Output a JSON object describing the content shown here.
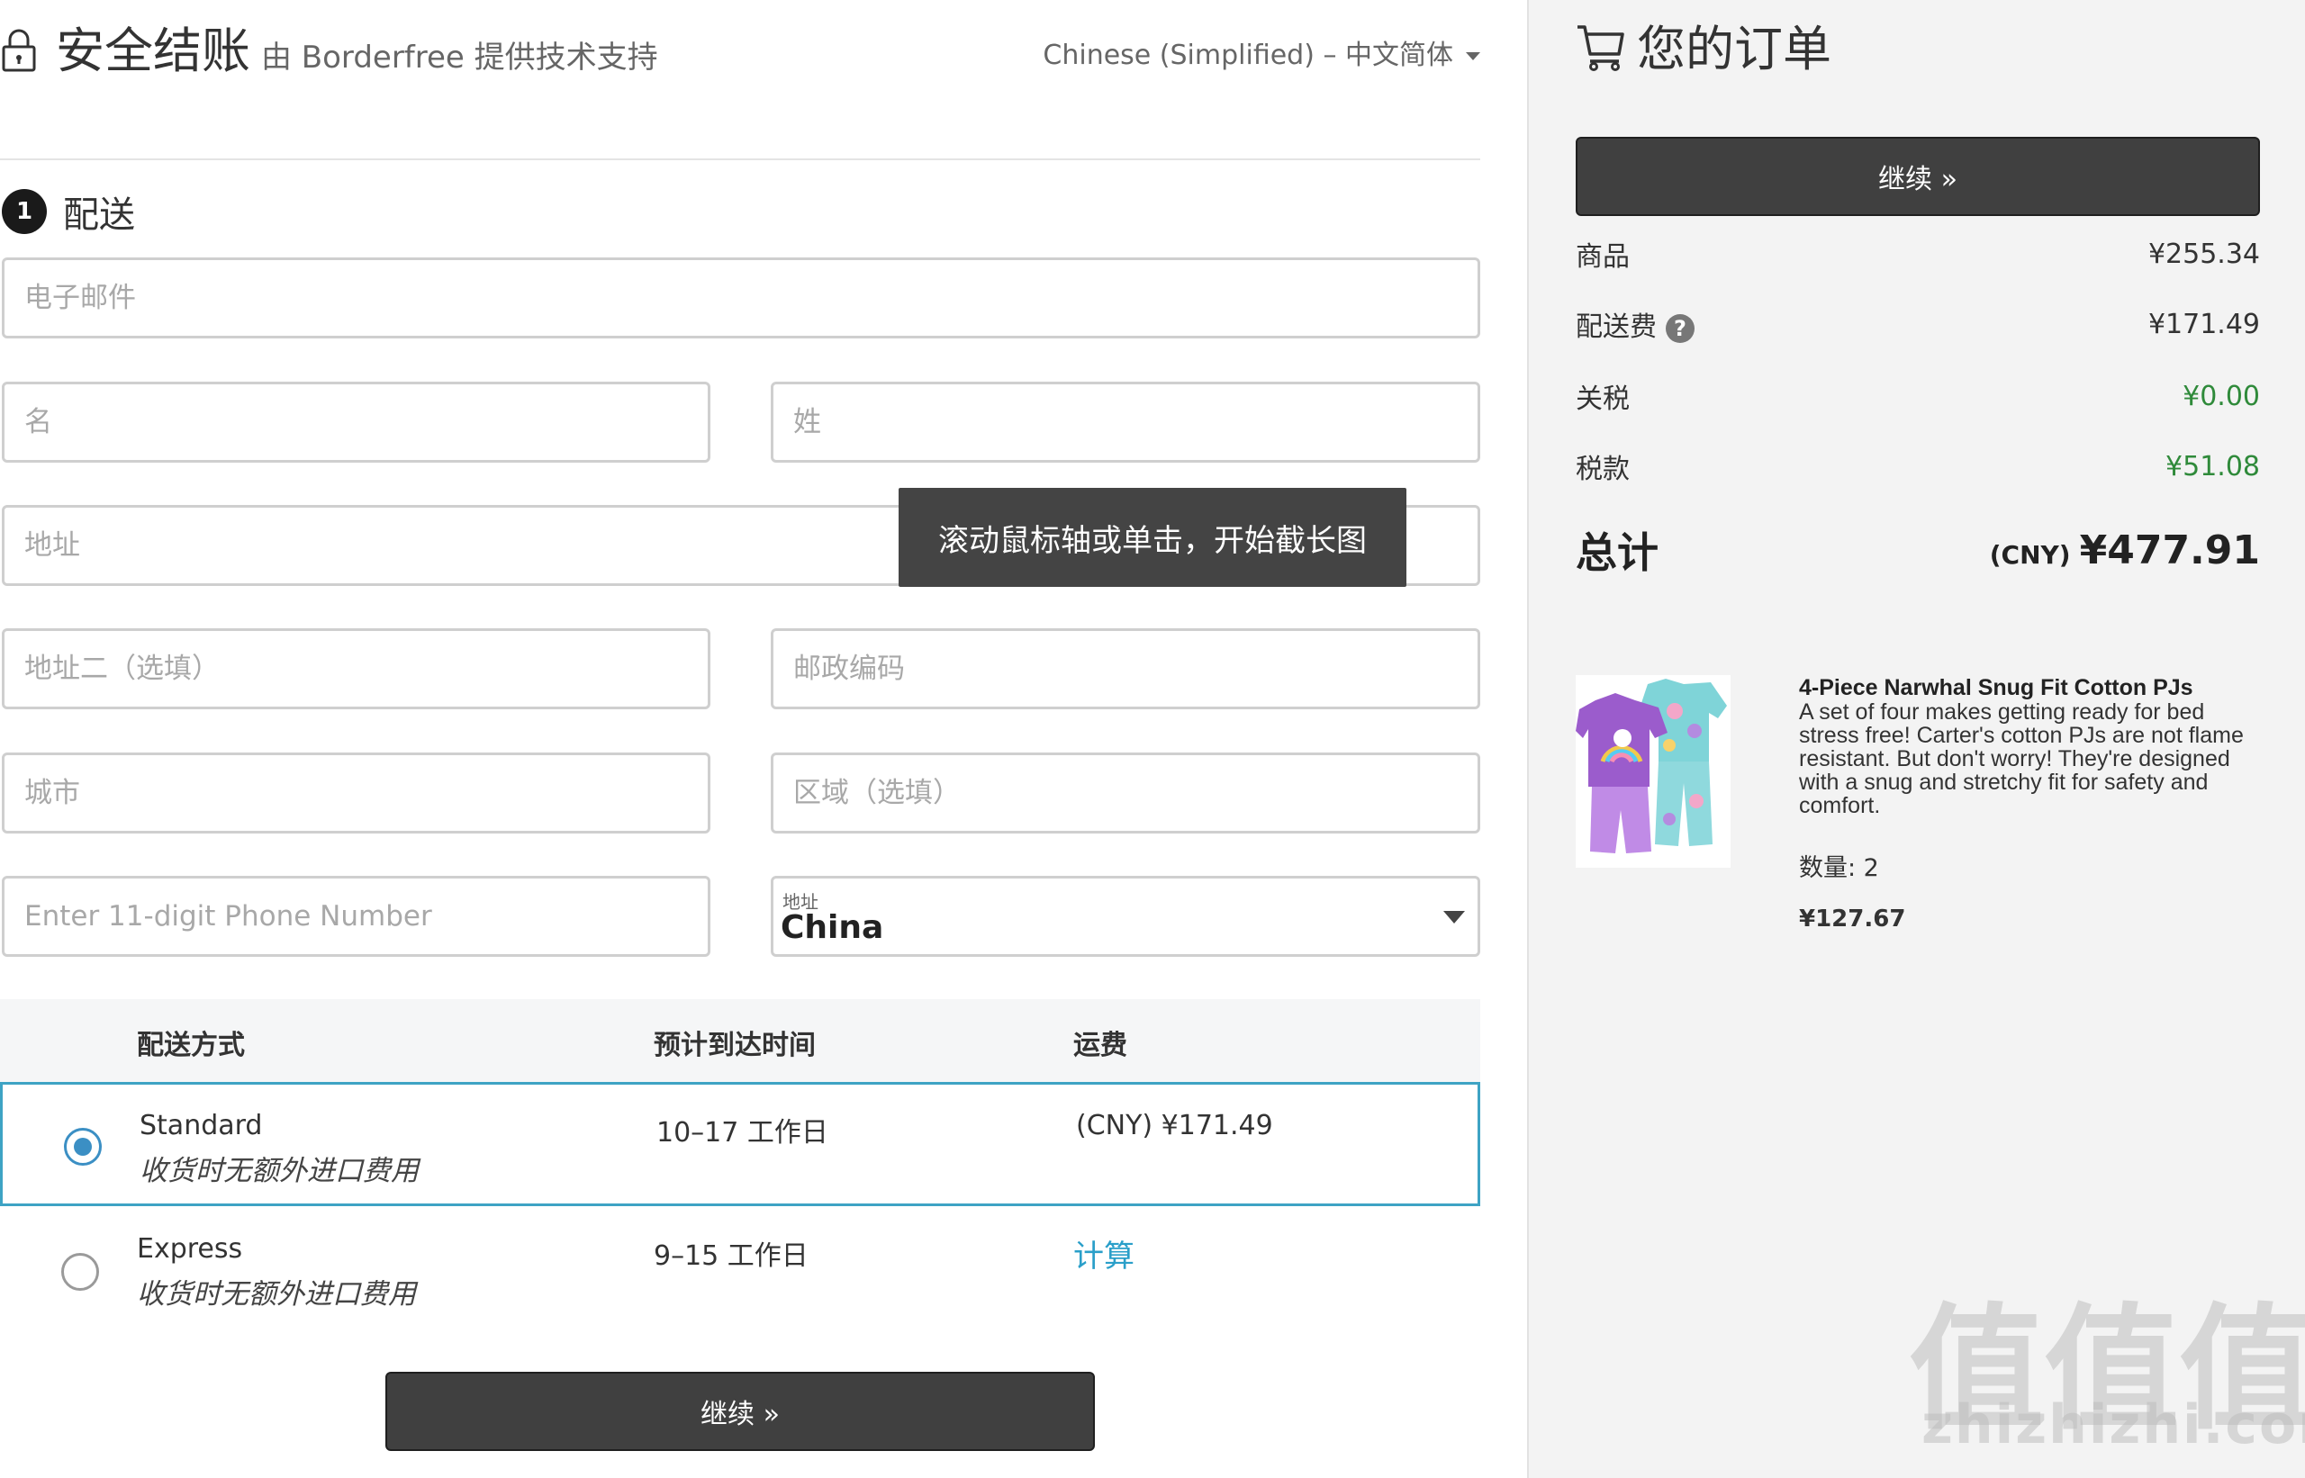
{
  "header": {
    "title": "安全结账",
    "powered_by": "由 Borderfree 提供技术支持",
    "language": "Chinese (Simplified) – 中文简体"
  },
  "step": {
    "number": "1",
    "title": "配送"
  },
  "form": {
    "email_placeholder": "电子邮件",
    "first_name_placeholder": "名",
    "last_name_placeholder": "姓",
    "address_placeholder": "地址",
    "address2_placeholder": "地址二（选填）",
    "postal_placeholder": "邮政编码",
    "city_placeholder": "城市",
    "region_placeholder": "区域（选填）",
    "phone_placeholder": "Enter 11-digit Phone Number",
    "country_label": "地址",
    "country_value": "China"
  },
  "tooltip": "滚动鼠标轴或单击，开始截长图",
  "shipping": {
    "headers": {
      "method": "配送方式",
      "eta": "预计到达时间",
      "cost": "运费"
    },
    "options": [
      {
        "name": "Standard",
        "note": "收货时无额外进口费用",
        "eta": "10–17 工作日",
        "cost": "(CNY) ¥171.49",
        "selected": true
      },
      {
        "name": "Express",
        "note": "收货时无额外进口费用",
        "eta": "9–15 工作日",
        "cost": "计算",
        "selected": false
      }
    ]
  },
  "continue_label": "继续 »",
  "order": {
    "title": "您的订单",
    "continue_label": "继续 »",
    "items_label": "商品",
    "items_value": "¥255.34",
    "shipping_label": "配送费",
    "shipping_value": "¥171.49",
    "duty_label": "关税",
    "duty_value": "¥0.00",
    "tax_label": "税款",
    "tax_value": "¥51.08",
    "total_label": "总计",
    "total_currency": "(CNY)",
    "total_value": "¥477.91",
    "accent_green": "#2f8a3a"
  },
  "product": {
    "title": "4-Piece Narwhal Snug Fit Cotton PJs",
    "description": "A set of four makes getting ready for bed stress free! Carter's cotton PJs are not flame resistant. But don't worry! They're designed with a snug and stretchy fit for safety and comfort.",
    "quantity": "数量: 2",
    "price": "¥127.67"
  },
  "watermark": {
    "glyph": "值",
    "text": "zhizhizhi.com"
  }
}
